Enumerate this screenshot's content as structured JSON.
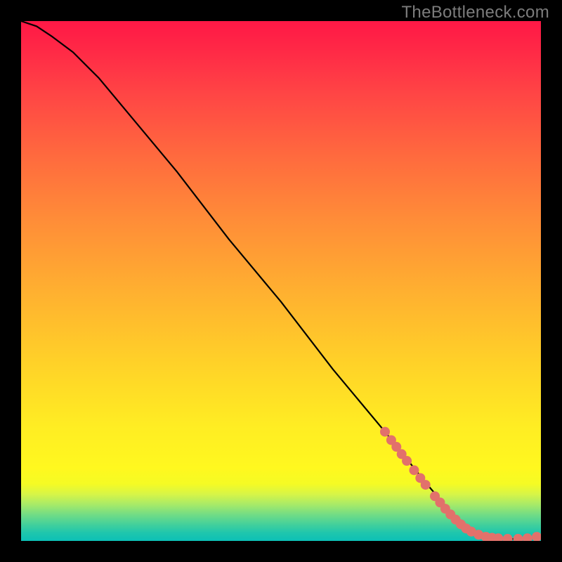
{
  "watermark": "TheBottleneck.com",
  "chart_data": {
    "type": "line",
    "title": "",
    "xlabel": "",
    "ylabel": "",
    "xlim": [
      0,
      100
    ],
    "ylim": [
      0,
      100
    ],
    "series": [
      {
        "name": "curve",
        "color": "#000000",
        "x": [
          0,
          3,
          6,
          10,
          15,
          20,
          30,
          40,
          50,
          60,
          70,
          78,
          84,
          88,
          92,
          96,
          100
        ],
        "y": [
          100,
          99,
          97,
          94,
          89,
          83,
          71,
          58,
          46,
          33,
          21,
          11,
          4,
          1.5,
          0.5,
          0.3,
          0.8
        ]
      }
    ],
    "points": [
      {
        "x": 70.0,
        "y": 21.0
      },
      {
        "x": 71.2,
        "y": 19.4
      },
      {
        "x": 72.2,
        "y": 18.1
      },
      {
        "x": 73.2,
        "y": 16.7
      },
      {
        "x": 74.2,
        "y": 15.4
      },
      {
        "x": 75.6,
        "y": 13.6
      },
      {
        "x": 76.8,
        "y": 12.1
      },
      {
        "x": 77.8,
        "y": 10.8
      },
      {
        "x": 79.6,
        "y": 8.6
      },
      {
        "x": 80.6,
        "y": 7.4
      },
      {
        "x": 81.6,
        "y": 6.2
      },
      {
        "x": 82.6,
        "y": 5.1
      },
      {
        "x": 83.6,
        "y": 4.1
      },
      {
        "x": 84.6,
        "y": 3.2
      },
      {
        "x": 85.6,
        "y": 2.4
      },
      {
        "x": 86.6,
        "y": 1.8
      },
      {
        "x": 88.0,
        "y": 1.2
      },
      {
        "x": 89.4,
        "y": 0.8
      },
      {
        "x": 90.6,
        "y": 0.6
      },
      {
        "x": 91.8,
        "y": 0.5
      },
      {
        "x": 93.6,
        "y": 0.4
      },
      {
        "x": 95.6,
        "y": 0.4
      },
      {
        "x": 97.4,
        "y": 0.5
      },
      {
        "x": 99.2,
        "y": 0.8
      }
    ],
    "points_color": "#e2716b",
    "points_radius": 7,
    "grid": false,
    "legend": false
  }
}
